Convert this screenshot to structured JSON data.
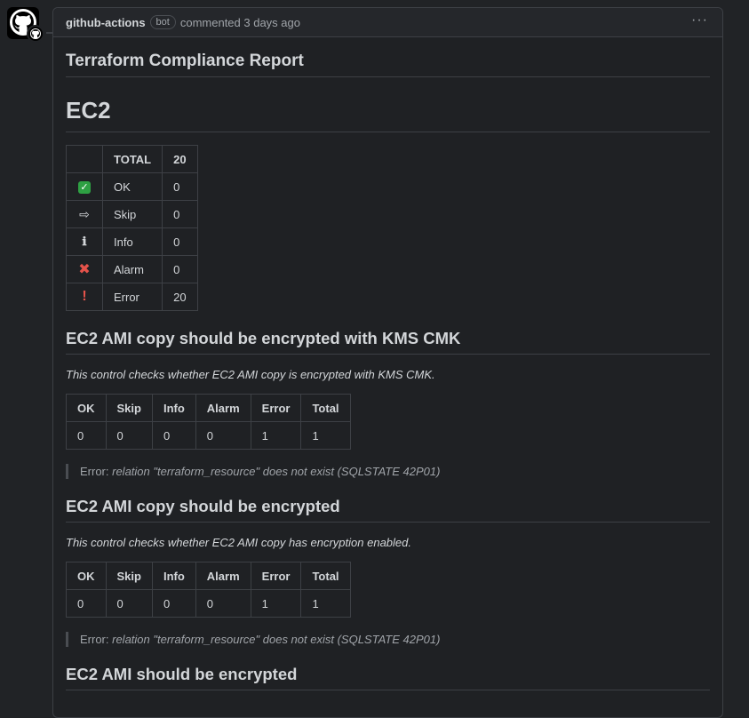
{
  "comment": {
    "author": "github-actions",
    "badge": "bot",
    "meta": "commented 3 days ago",
    "menu_glyph": "···"
  },
  "report": {
    "title": "Terraform Compliance Report",
    "section_title": "EC2",
    "summary": {
      "header": [
        "",
        "TOTAL",
        "20"
      ],
      "rows": [
        {
          "icon": "check-mark-icon",
          "glyph": "✓",
          "label": "OK",
          "value": "0"
        },
        {
          "icon": "skip-arrow-icon",
          "glyph": "⇨",
          "label": "Skip",
          "value": "0"
        },
        {
          "icon": "info-icon",
          "glyph": "ℹ",
          "label": "Info",
          "value": "0"
        },
        {
          "icon": "cross-mark-icon",
          "glyph": "✖",
          "label": "Alarm",
          "value": "0"
        },
        {
          "icon": "exclamation-icon",
          "glyph": "!",
          "label": "Error",
          "value": "20"
        }
      ]
    },
    "controls": [
      {
        "title": "EC2 AMI copy should be encrypted with KMS CMK",
        "description": "This control checks whether EC2 AMI copy is encrypted with KMS CMK.",
        "columns": [
          "OK",
          "Skip",
          "Info",
          "Alarm",
          "Error",
          "Total"
        ],
        "values": [
          "0",
          "0",
          "0",
          "0",
          "1",
          "1"
        ],
        "error_label": "Error: ",
        "error_message": "relation \"terraform_resource\" does not exist (SQLSTATE 42P01)"
      },
      {
        "title": "EC2 AMI copy should be encrypted",
        "description": "This control checks whether EC2 AMI copy has encryption enabled.",
        "columns": [
          "OK",
          "Skip",
          "Info",
          "Alarm",
          "Error",
          "Total"
        ],
        "values": [
          "0",
          "0",
          "0",
          "0",
          "1",
          "1"
        ],
        "error_label": "Error: ",
        "error_message": "relation \"terraform_resource\" does not exist (SQLSTATE 42P01)"
      },
      {
        "title": "EC2 AMI should be encrypted"
      }
    ]
  }
}
